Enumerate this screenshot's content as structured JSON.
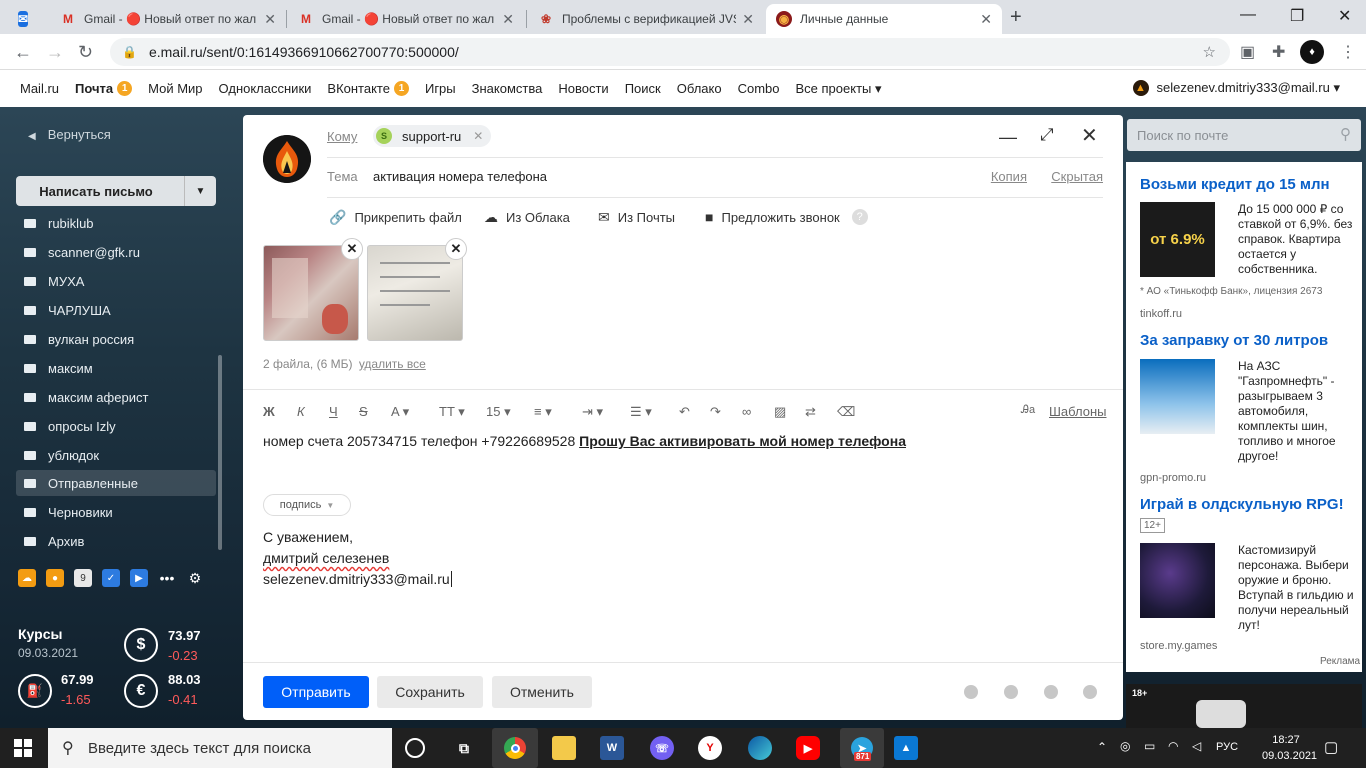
{
  "browser": {
    "tabs": [
      {
        "title": "",
        "active": false
      },
      {
        "title": "Gmail - 🔴 Новый ответ по жал",
        "active": false
      },
      {
        "title": "Gmail - 🔴 Новый ответ по жал",
        "active": false
      },
      {
        "title": "Проблемы с верификацией JVS",
        "active": false
      },
      {
        "title": "Личные данные",
        "active": false
      }
    ],
    "new_tab": "+",
    "address": "e.mail.ru/sent/0:16149366910662700770:500000/"
  },
  "portal": {
    "links": [
      "Mail.ru",
      "Почта",
      "Мой Мир",
      "Одноклассники",
      "ВКонтакте",
      "Игры",
      "Знакомства",
      "Новости",
      "Поиск",
      "Облако",
      "Combo",
      "Все проекты ▾"
    ],
    "mail_badge": "1",
    "vk_badge": "1",
    "user": "selezenev.dmitriy333@mail.ru ▾"
  },
  "sidebar": {
    "back": "Вернуться",
    "compose": "Написать письмо",
    "folders": [
      "rubiklub",
      "scanner@gfk.ru",
      "МУХА",
      "ЧАРЛУША",
      "вулкан россия",
      "максим",
      "максим аферист",
      "опросы Izly",
      "ублюдок",
      "Отправленные",
      "Черновики",
      "Архив"
    ],
    "selected_folder": "Отправленные",
    "rates": {
      "title": "Курсы",
      "date": "09.03.2021",
      "usd": "73.97",
      "usd_change": "-0.23",
      "oil": "67.99",
      "oil_change": "-1.65",
      "eur": "88.03",
      "eur_change": "-0.41"
    }
  },
  "compose": {
    "to_label": "Кому",
    "to_chip": "support-ru",
    "subject_label": "Тема",
    "subject": "активация номера телефона",
    "cc": "Копия",
    "bcc": "Скрытая",
    "attach_file": "Прикрепить файл",
    "from_cloud": "Из Облака",
    "from_mail": "Из Почты",
    "suggest_call": "Предложить звонок",
    "files_info": "2 файла, (6 МБ)",
    "delete_all": "удалить все",
    "font_size": "15",
    "templates": "Шаблоны",
    "body_plain": "номер счета 205734715 телефон +79226689528 ",
    "body_bold": "Прошу Вас активировать мой номер телефона",
    "signature_btn": "подпись",
    "sig_line1": "С уважением,",
    "sig_line2": "дмитрий селезенев",
    "sig_line3": "selezenev.dmitriy333@mail.ru",
    "send": "Отправить",
    "save": "Сохранить",
    "cancel": "Отменить"
  },
  "search": {
    "placeholder": "Поиск по почте"
  },
  "ads": {
    "ad1_title": "Возьми кредит до 15 млн",
    "ad1_img_text": "от 6.9%",
    "ad1_text": "До 15 000 000 ₽ со ставкой от 6,9%. без справок. Квартира остается у собственника.",
    "ad1_note": "* АО «Тинькофф Банк», лицензия 2673",
    "ad1_src": "tinkoff.ru",
    "ad2_title": "За заправку от 30 литров",
    "ad2_text": "На АЗС \"Газпромнефть\" - разыгрываем 3 автомобиля, комплекты шин, топливо и многое другое!",
    "ad2_src": "gpn-promo.ru",
    "ad3_title": "Играй в олдскульную RPG!",
    "ad3_age": "12+",
    "ad3_text": "Кастомизируй персонажа. Выбери оружие и броню. Вступай в гильдию и получи нереальный лут!",
    "ad3_src": "store.my.games",
    "ad_label": "Реклама",
    "age18": "18+"
  },
  "taskbar": {
    "search": "Введите здесь текст для поиска",
    "lang": "РУС",
    "time": "18:27",
    "date": "09.03.2021",
    "tg_badge": "871"
  },
  "colors": {
    "accent": "#005ff9",
    "link": "#0a60c8",
    "negative": "#ff5a5a",
    "badge": "#f5a623"
  }
}
